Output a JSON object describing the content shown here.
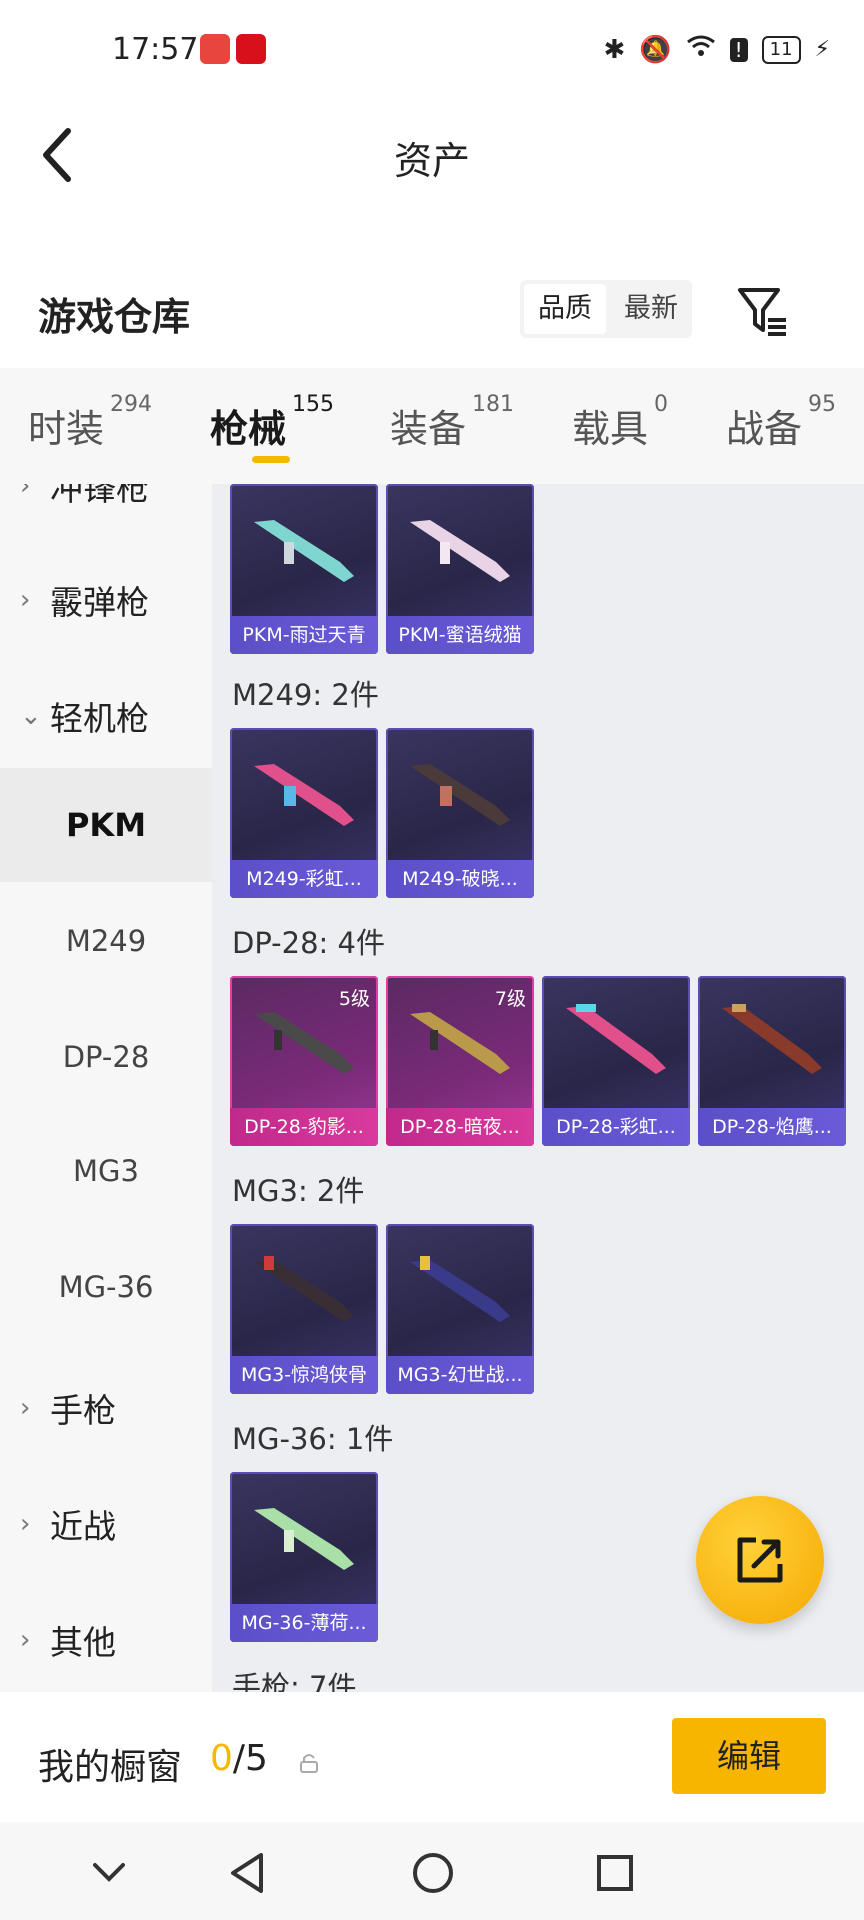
{
  "status_bar": {
    "time": "17:57",
    "battery": "11"
  },
  "header": {
    "title": "资产"
  },
  "section": {
    "title": "游戏仓库"
  },
  "sort": {
    "options": [
      "品质",
      "最新"
    ],
    "active": "品质"
  },
  "tabs": [
    {
      "label": "时装",
      "count": "294"
    },
    {
      "label": "枪械",
      "count": "155"
    },
    {
      "label": "装备",
      "count": "181"
    },
    {
      "label": "载具",
      "count": "0"
    },
    {
      "label": "战备",
      "count": "95"
    }
  ],
  "sidebar": {
    "categories": [
      "冲锋枪",
      "霰弹枪",
      "轻机枪",
      "手枪",
      "近战",
      "其他"
    ],
    "subitems": [
      "PKM",
      "M249",
      "DP-28",
      "MG3",
      "MG-36"
    ],
    "active": "PKM"
  },
  "groups": [
    {
      "title": "",
      "items": [
        {
          "name": "PKM-雨过天青"
        },
        {
          "name": "PKM-蜜语绒猫"
        }
      ]
    },
    {
      "title": "M249: 2件",
      "items": [
        {
          "name": "M249-彩虹..."
        },
        {
          "name": "M249-破晓..."
        }
      ]
    },
    {
      "title": "DP-28: 4件",
      "items": [
        {
          "name": "DP-28-豹影...",
          "level": "5级"
        },
        {
          "name": "DP-28-暗夜...",
          "level": "7级"
        },
        {
          "name": "DP-28-彩虹..."
        },
        {
          "name": "DP-28-焰鹰..."
        }
      ]
    },
    {
      "title": "MG3: 2件",
      "items": [
        {
          "name": "MG3-惊鸿侠骨"
        },
        {
          "name": "MG3-幻世战..."
        }
      ]
    },
    {
      "title": "MG-36: 1件",
      "items": [
        {
          "name": "MG-36-薄荷..."
        }
      ]
    },
    {
      "title": "手枪: 7件",
      "items": []
    }
  ],
  "showcase": {
    "label": "我的橱窗",
    "current": "0",
    "total": "/5"
  },
  "edit_button": {
    "label": "编辑"
  },
  "colors": {
    "accent": "#f7b500",
    "card_blue": "#5b4fc7",
    "card_pink": "#d93a9c"
  }
}
